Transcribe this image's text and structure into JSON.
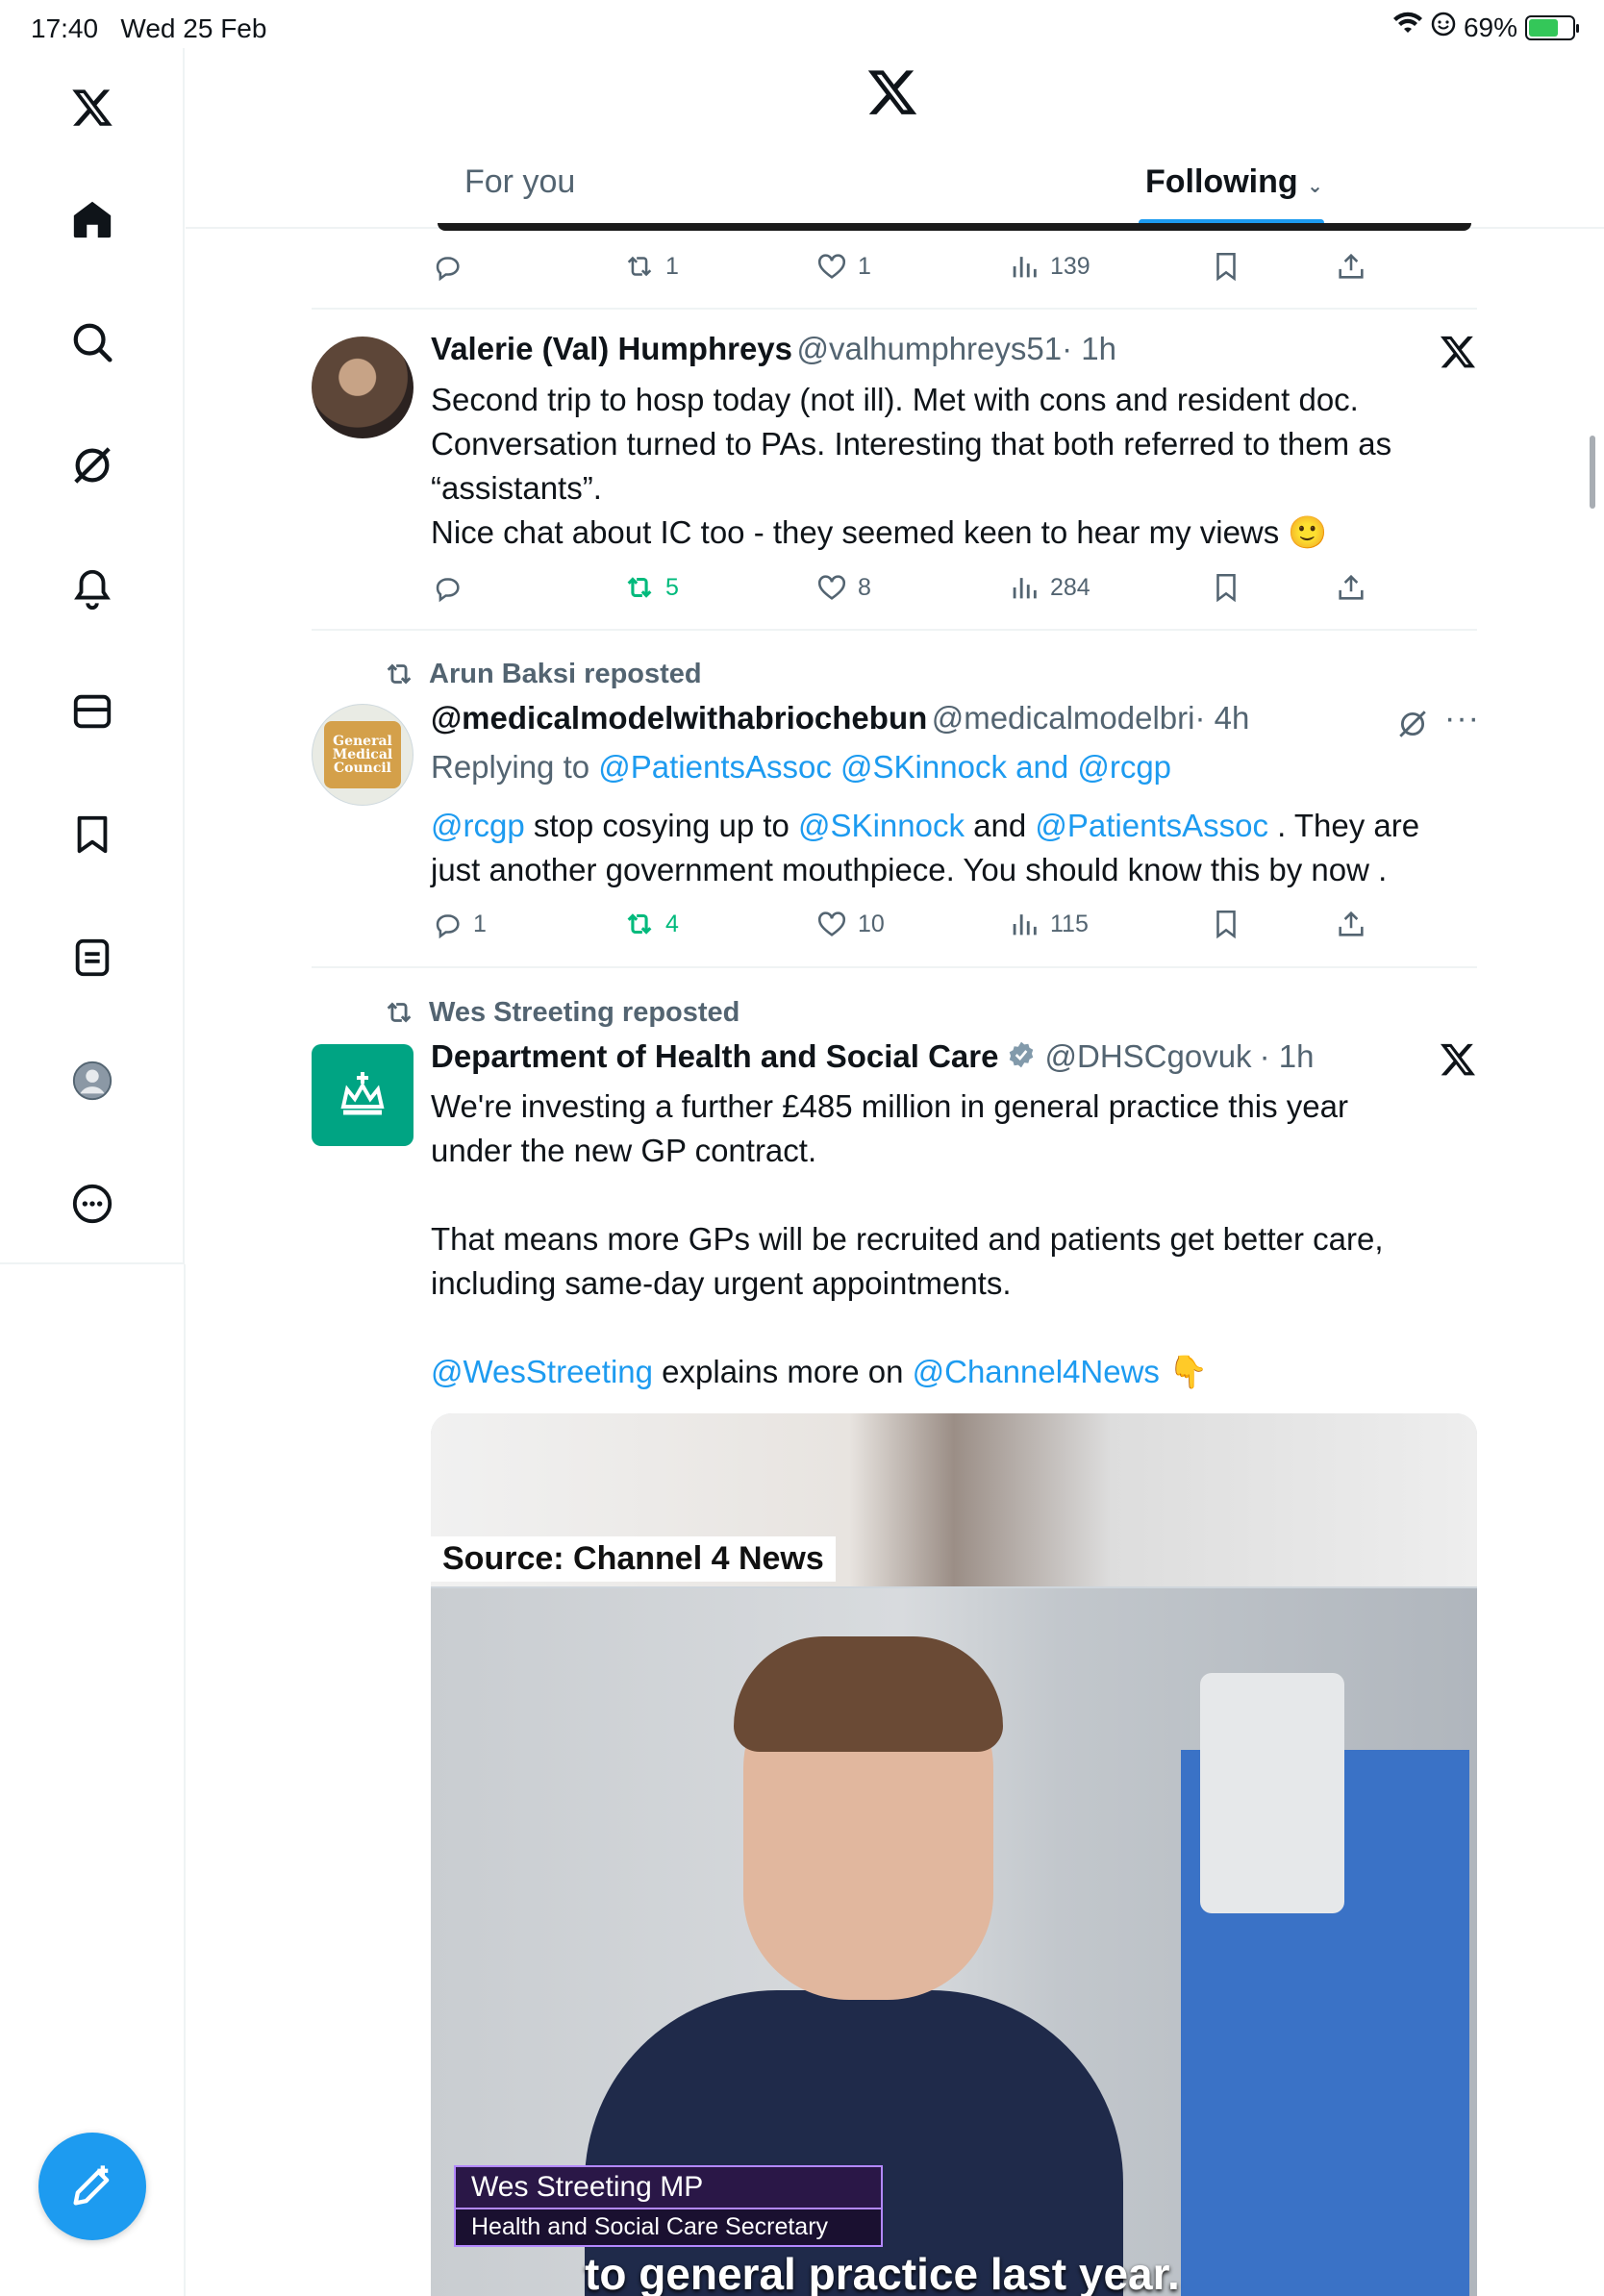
{
  "status": {
    "time": "17:40",
    "date": "Wed 25 Feb",
    "battery": "69%",
    "battery_level": 0.69
  },
  "tabs": {
    "for_you": "For you",
    "following": "Following"
  },
  "sidebar": {
    "items": [
      "home-icon",
      "search-icon",
      "grok-icon",
      "notifications-icon",
      "messages-icon",
      "bookmarks-icon",
      "lists-icon",
      "profile-icon",
      "more-icon"
    ]
  },
  "top_partial": {
    "reply": "",
    "repost": "1",
    "like": "1",
    "views": "139"
  },
  "tweet1": {
    "name": "Valerie (Val) Humphreys",
    "handle": "@valhumphreys51",
    "time": "· 1h",
    "lines": [
      "Second trip to hosp today (not ill). Met with cons and resident doc.",
      "Conversation turned to PAs. Interesting that both referred to them as",
      "“assistants”.",
      "Nice chat about IC too - they seemed keen to hear my views 🙂"
    ],
    "reply": "",
    "repost": "5",
    "like": "8",
    "views": "284"
  },
  "tweet2": {
    "reposted_by": "Arun Baksi reposted",
    "name": "@medicalmodelwithabriochebun",
    "handle": "@medicalmodelbri",
    "time": "· 4h",
    "replying_label": "Replying to ",
    "replying_to": "@PatientsAssoc @SKinnock and @rcgp",
    "m1": "@rcgp",
    "t1": " stop cosying up to ",
    "m2": "@SKinnock",
    "t2": " and ",
    "m3": "@PatientsAssoc",
    "t3": " . They are",
    "line2": "just another government mouthpiece. You should know this by now .",
    "avatar_text": "General Medical Council",
    "reply": "1",
    "repost": "4",
    "like": "10",
    "views": "115",
    "more": "···"
  },
  "tweet3": {
    "reposted_by": "Wes Streeting reposted",
    "name": "Department of Health and Social Care",
    "handle": "@DHSCgovuk",
    "time": "· 1h",
    "p1a": "We're investing a further £485 million in general practice this year",
    "p1b": "under the new GP contract.",
    "p2a": "That means more GPs will be recruited and patients get better care,",
    "p2b": "including same-day urgent appointments.",
    "m1": "@WesStreeting",
    "t1": " explains more on ",
    "m2": "@Channel4News",
    "emoji": " 👇"
  },
  "media": {
    "source": "Source: Channel 4 News",
    "lower_third_name": "Wes Streeting MP",
    "lower_third_title": "Health and Social Care Secretary",
    "caption": "to general practice last year."
  },
  "colors": {
    "accent": "#1d9bf0",
    "repost_green": "#00ba7c",
    "dhsc_green": "#00a483"
  }
}
